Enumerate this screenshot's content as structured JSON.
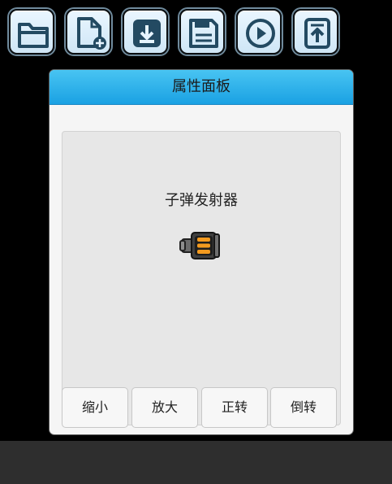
{
  "toolbar": {
    "buttons": [
      {
        "name": "open-folder",
        "icon": "folder-icon"
      },
      {
        "name": "new-file",
        "icon": "new-file-icon"
      },
      {
        "name": "download",
        "icon": "download-icon"
      },
      {
        "name": "save",
        "icon": "save-icon"
      },
      {
        "name": "play",
        "icon": "play-icon"
      },
      {
        "name": "upload",
        "icon": "upload-icon"
      }
    ]
  },
  "panel": {
    "title": "属性面板",
    "item_name": "子弹发射器",
    "item_icon": "bullet-launcher-icon",
    "buttons": {
      "zoom_out": "缩小",
      "zoom_in": "放大",
      "rotate_cw": "正转",
      "rotate_ccw": "倒转"
    }
  },
  "colors": {
    "header": "#1aa1e3",
    "icon_stroke": "#234a62",
    "background": "#000000"
  }
}
